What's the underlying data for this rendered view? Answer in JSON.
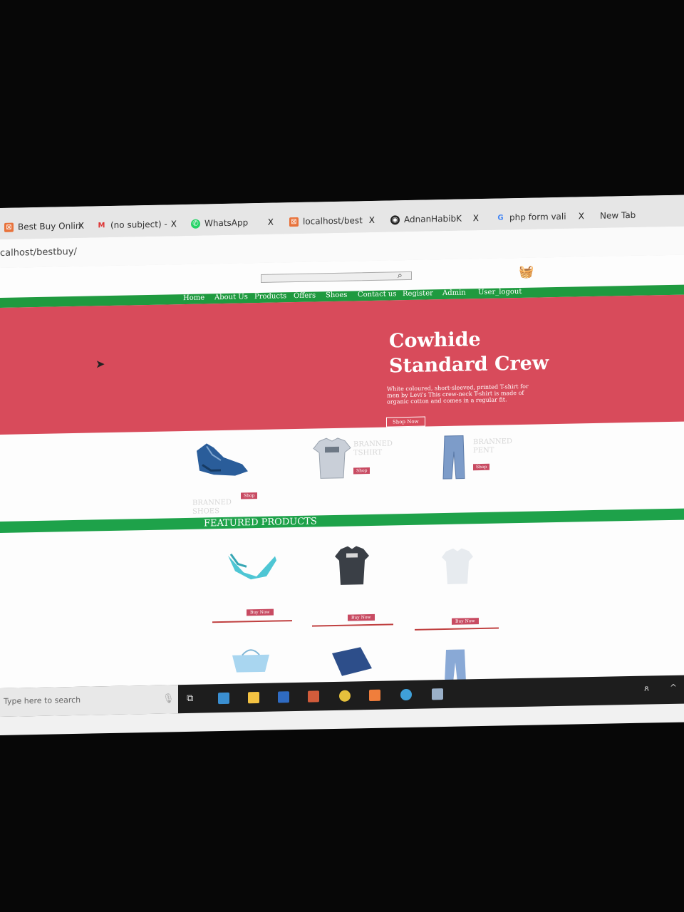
{
  "browser": {
    "tabs": [
      {
        "label": "Best Buy Onlin",
        "icon": "xampp-icon",
        "close": "X"
      },
      {
        "label": "(no subject) -",
        "icon": "gmail-icon",
        "close": "X"
      },
      {
        "label": "WhatsApp",
        "icon": "whatsapp-icon",
        "close": "X"
      },
      {
        "label": "localhost/best",
        "icon": "xampp-icon",
        "close": "X"
      },
      {
        "label": "AdnanHabibK",
        "icon": "github-icon",
        "close": "X"
      },
      {
        "label": "php form vali",
        "icon": "google-icon",
        "close": "X"
      },
      {
        "label": "New Tab"
      }
    ],
    "url": "calhost/bestbuy/"
  },
  "nav": {
    "items": [
      "Home",
      "About Us",
      "Products",
      "Offers",
      "Shoes",
      "Contact us",
      "Register",
      "Admin",
      "User_logout"
    ]
  },
  "hero": {
    "title": "Cowhide Standard Crew",
    "description": "White coloured, short-sleeved, printed T-shirt for men by Levi's This crew-neck T-shirt is made of organic cotton and comes in a regular fit.",
    "button": "Shop Now",
    "bg_color": "#d84b5b"
  },
  "categories": [
    {
      "label": "BRANNED SHOES",
      "button": "Shop"
    },
    {
      "label": "BRANNED TSHIRT",
      "button": "Shop"
    },
    {
      "label": "BRANNED PENT",
      "button": "Shop"
    }
  ],
  "featured": {
    "title": "FEATURED PRODUCTS",
    "buttons": [
      "Buy Now",
      "Buy Now",
      "Buy Now"
    ]
  },
  "taskbar": {
    "search_placeholder": "Type here to search"
  },
  "colors": {
    "nav_green": "#1f9a3f",
    "accent_red": "#c84b62"
  }
}
